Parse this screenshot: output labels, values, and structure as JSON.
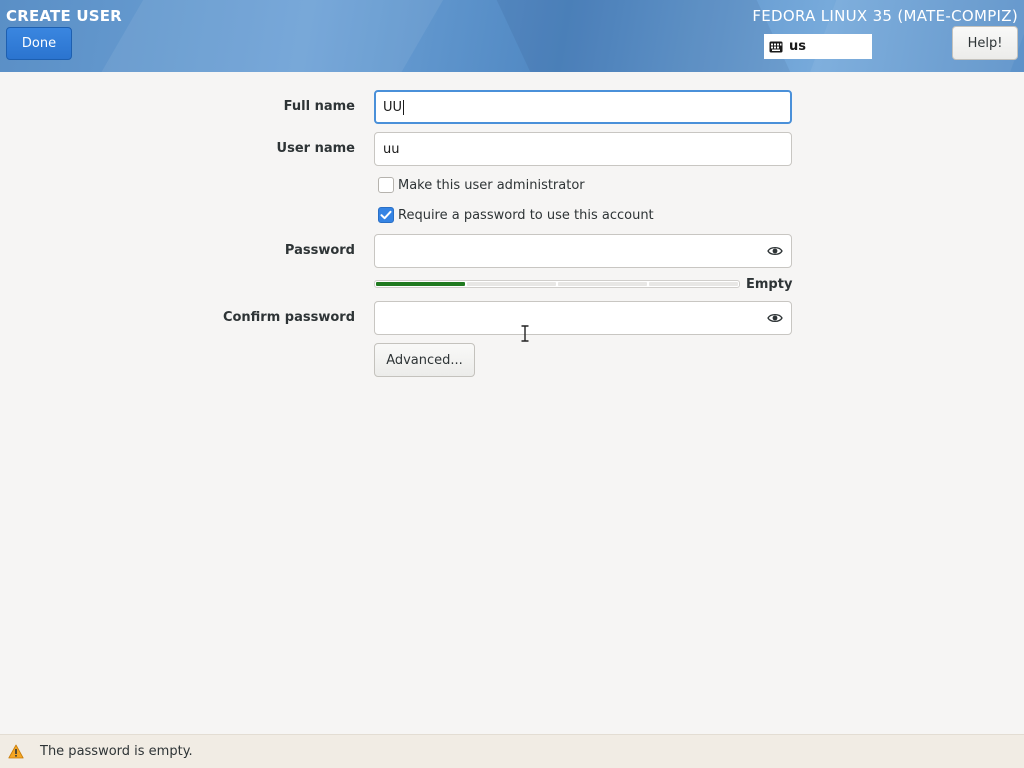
{
  "header": {
    "title": "CREATE USER",
    "done_label": "Done",
    "distro": "FEDORA LINUX 35 (MATE-COMPIZ)",
    "keyboard_layout": "us",
    "help_label": "Help!"
  },
  "form": {
    "full_name": {
      "label": "Full name",
      "value": "UU"
    },
    "user_name": {
      "label": "User name",
      "value": "uu"
    },
    "admin_checkbox": {
      "label": "Make this user administrator",
      "checked": false
    },
    "require_password_checkbox": {
      "label": "Require a password to use this account",
      "checked": true
    },
    "password": {
      "label": "Password",
      "value": ""
    },
    "strength": {
      "label": "Empty",
      "level": 0.25
    },
    "confirm_password": {
      "label": "Confirm password",
      "value": ""
    },
    "advanced_label": "Advanced..."
  },
  "status": {
    "message": "The password is empty."
  },
  "colors": {
    "accent": "#3584e4",
    "strength_fill": "#207a20",
    "warning": "#f5a623"
  }
}
